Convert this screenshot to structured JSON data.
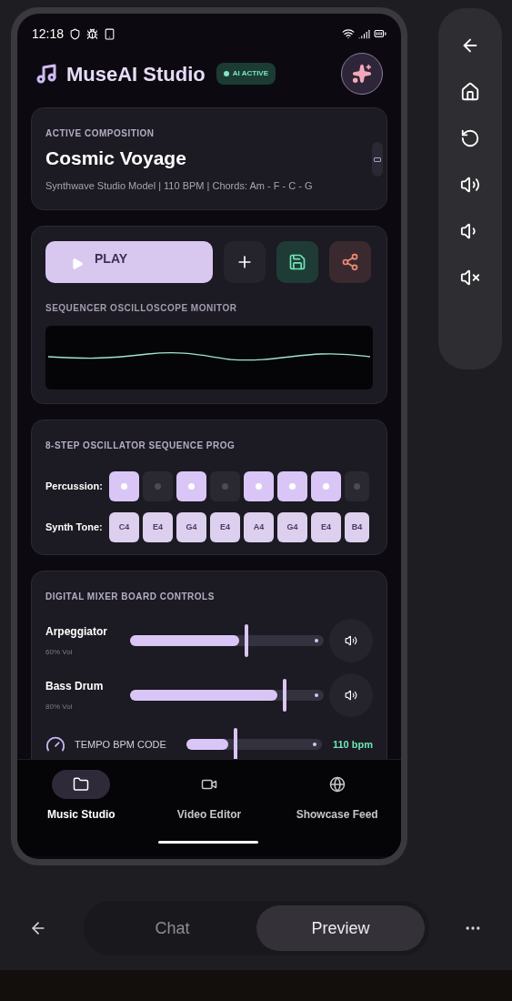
{
  "status_bar": {
    "time": "12:18"
  },
  "header": {
    "title": "MuseAI Studio",
    "badge": "AI ACTIVE"
  },
  "composition": {
    "label": "ACTIVE COMPOSITION",
    "title": "Cosmic Voyage",
    "details": "Synthwave Studio Model | 110 BPM | Chords: Am - F - C - G"
  },
  "transport": {
    "play_label": "PLAY",
    "monitor_label": "SEQUENCER OSCILLOSCOPE MONITOR"
  },
  "sequencer": {
    "title": "8-STEP OSCILLATOR SEQUENCE PROG",
    "percussion_label": "Percussion:",
    "percussion": [
      {
        "on": true
      },
      {
        "on": false
      },
      {
        "on": true
      },
      {
        "on": false
      },
      {
        "on": true
      },
      {
        "on": true
      },
      {
        "on": true
      },
      {
        "on": false
      }
    ],
    "synth_label": "Synth Tone:",
    "synth": [
      "C4",
      "E4",
      "G4",
      "E4",
      "A4",
      "G4",
      "E4",
      "B4"
    ]
  },
  "mixer": {
    "title": "DIGITAL MIXER BOARD CONTROLS",
    "channels": [
      {
        "name": "Arpeggiator",
        "reading": "60% Vol",
        "level": 0.6
      },
      {
        "name": "Bass Drum",
        "reading": "80% Vol",
        "level": 0.8
      }
    ],
    "tempo": {
      "label": "TEMPO BPM CODE",
      "level": 0.36,
      "reading": "110 bpm"
    }
  },
  "bottom_nav": [
    {
      "label": "Music Studio",
      "selected": true
    },
    {
      "label": "Video Editor",
      "selected": false
    },
    {
      "label": "Showcase Feed",
      "selected": false
    }
  ],
  "footer": {
    "tabs": [
      {
        "label": "Chat",
        "selected": false
      },
      {
        "label": "Preview",
        "selected": true
      }
    ]
  }
}
